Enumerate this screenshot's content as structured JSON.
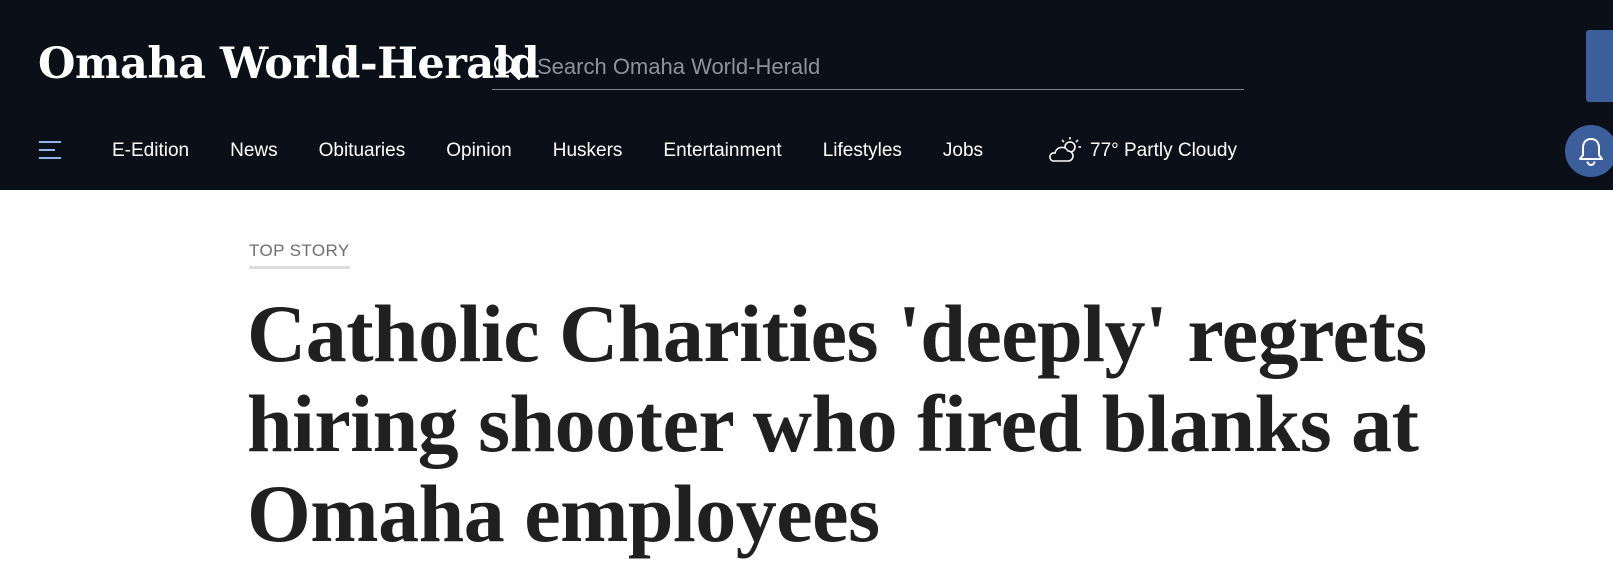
{
  "header": {
    "logo_text": "Omaha World-Herald",
    "search": {
      "placeholder": "Search Omaha World-Herald",
      "icon": "search-icon"
    },
    "colors": {
      "background": "#0b0f17",
      "accent": "#3c5f9c"
    }
  },
  "nav": {
    "menu_icon": "hamburger-menu-icon",
    "items": [
      {
        "label": "E-Edition"
      },
      {
        "label": "News"
      },
      {
        "label": "Obituaries"
      },
      {
        "label": "Opinion"
      },
      {
        "label": "Huskers"
      },
      {
        "label": "Entertainment"
      },
      {
        "label": "Lifestyles"
      },
      {
        "label": "Jobs"
      }
    ],
    "weather": {
      "icon": "partly-cloudy-icon",
      "text": "77° Partly Cloudy"
    },
    "notification_icon": "bell-icon"
  },
  "article": {
    "kicker": "TOP STORY",
    "headline": "Catholic Charities 'deeply' regrets hiring shooter who fired blanks at Omaha employees"
  }
}
